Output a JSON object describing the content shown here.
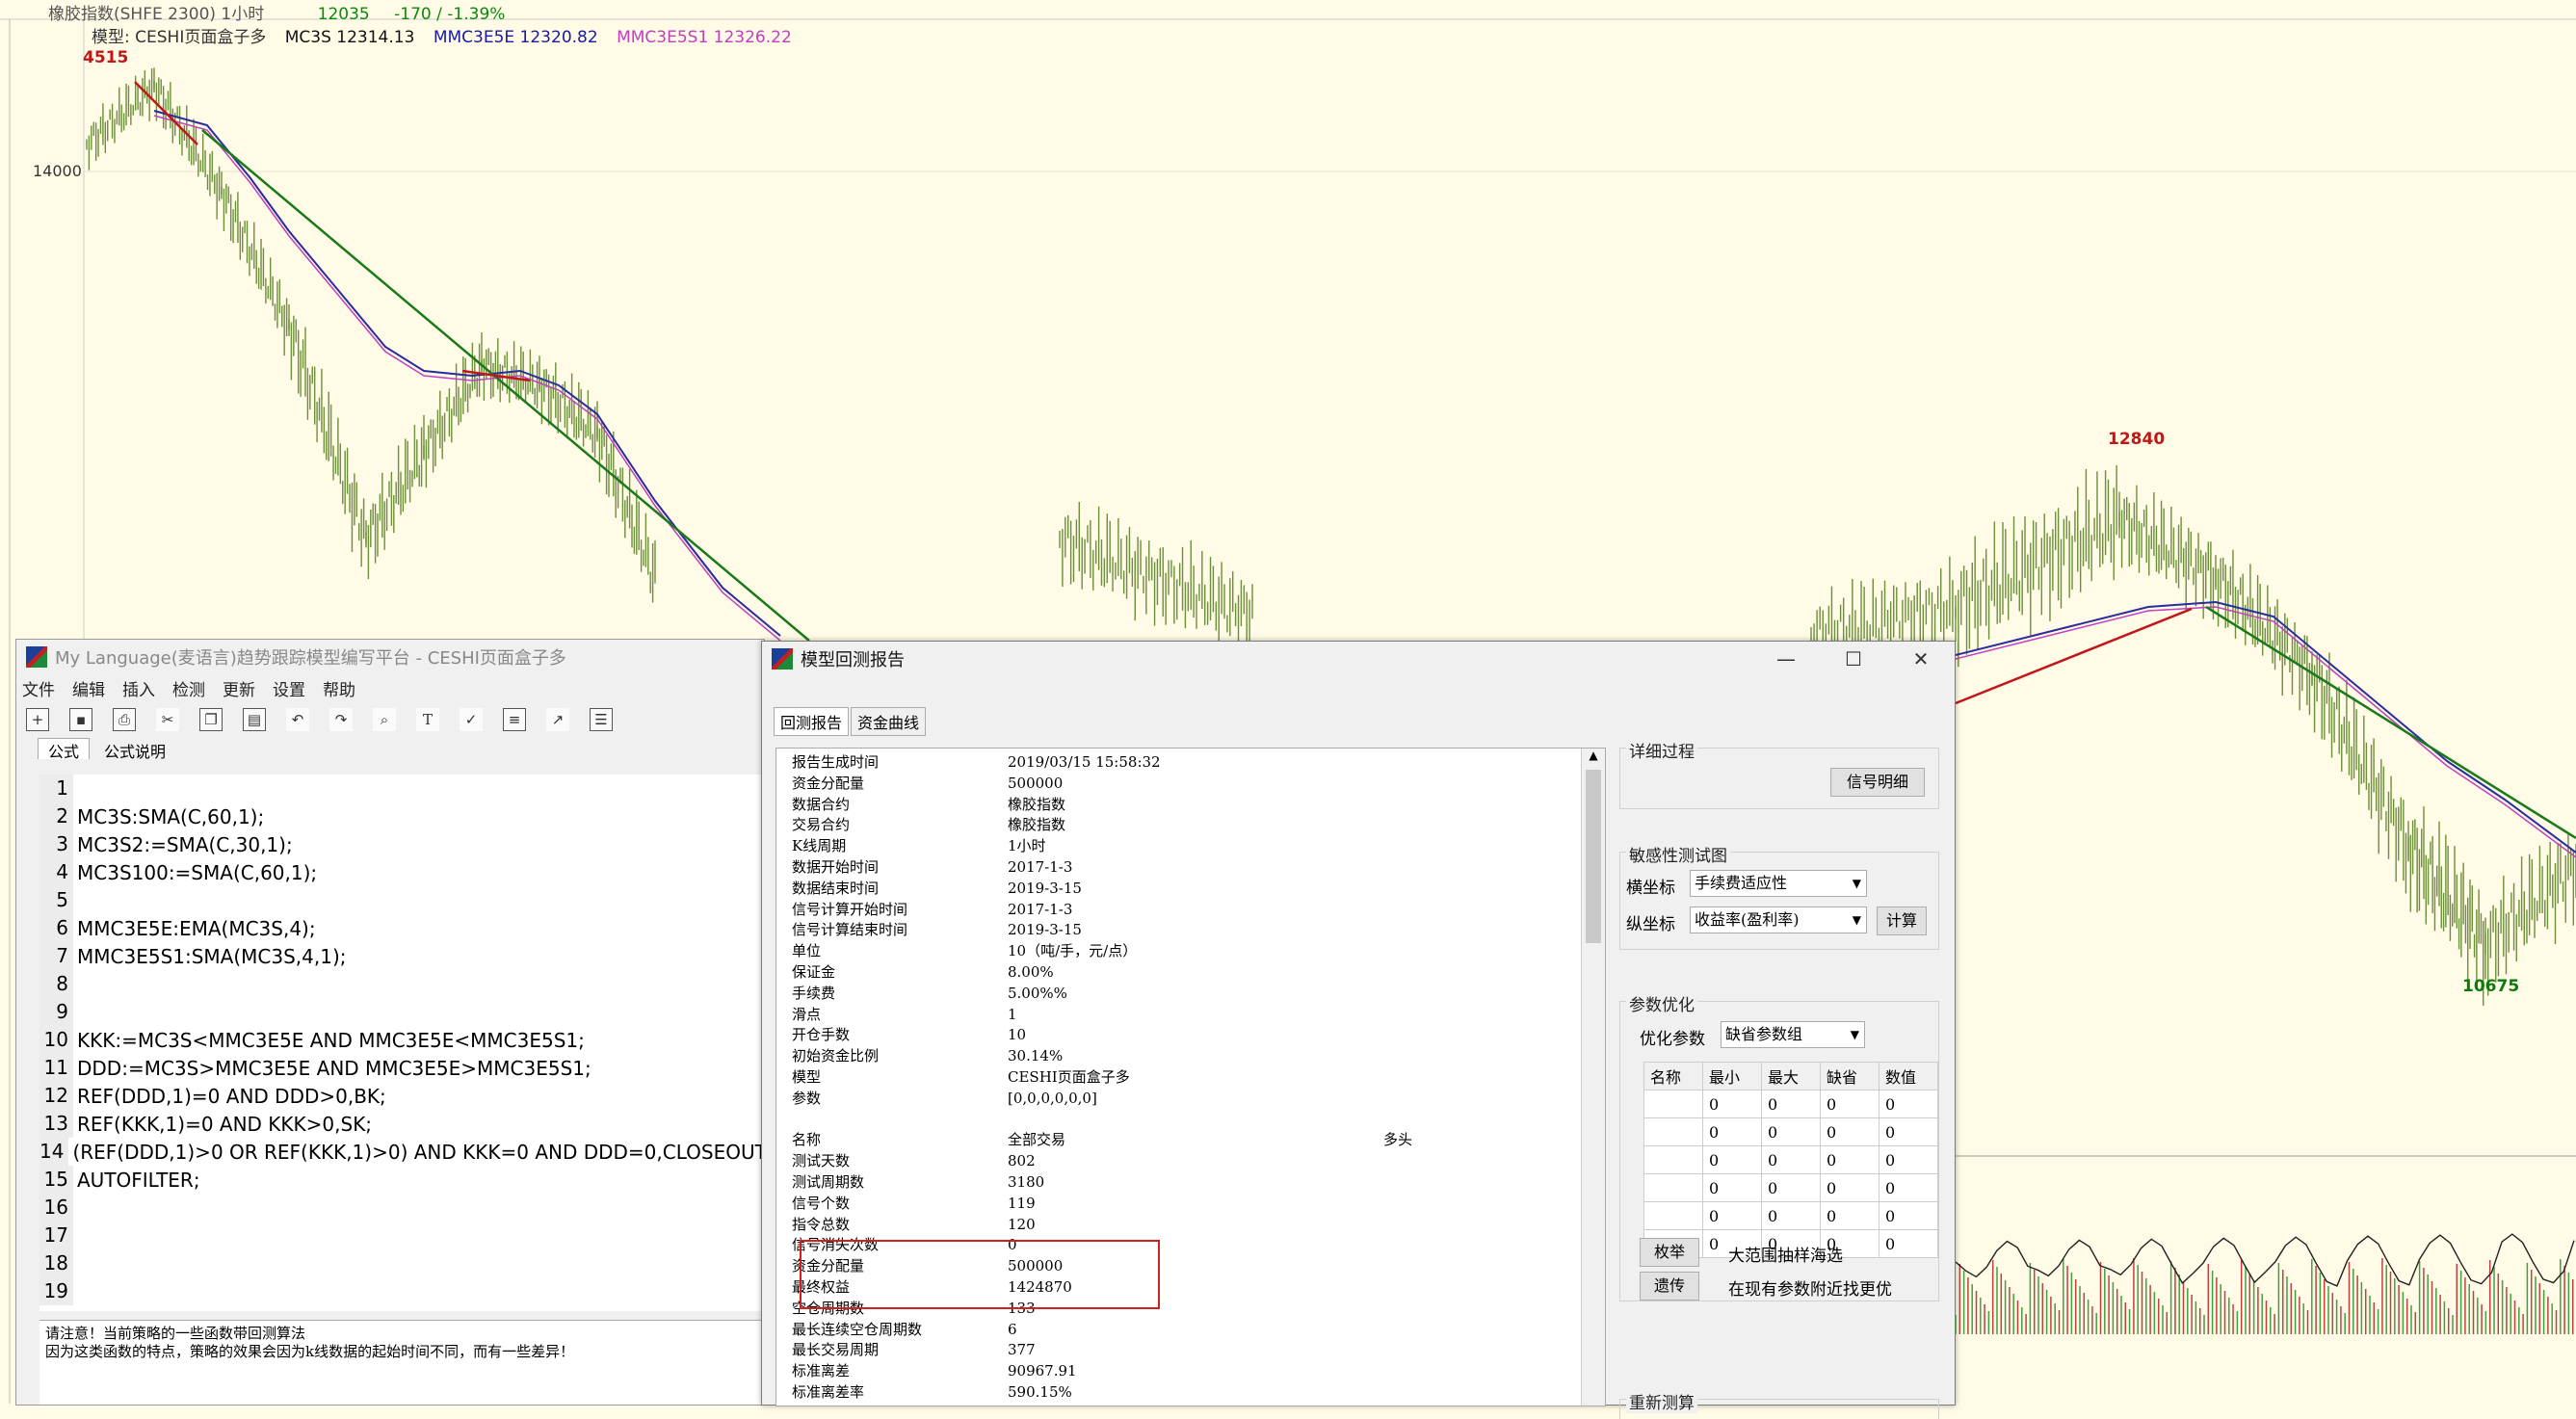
{
  "chart": {
    "header": "橡胶指数(SHFE 2300) 1小时",
    "last_price": "12035",
    "change": "-170 / -1.39%",
    "legend": [
      {
        "label": "模型: CESHI页面盒子多",
        "color": "#333333"
      },
      {
        "label": "MC3S 12314.13",
        "color": "#111111"
      },
      {
        "label": "MMC3E5E 12320.82",
        "color": "#1a1aa0"
      },
      {
        "label": "MMC3E5S1 12326.22",
        "color": "#c040c0"
      }
    ],
    "y_axis_label": "14000",
    "high_label": "4515",
    "mid_high_label": "12840",
    "low_label": "10675",
    "colors": {
      "price": "#6b8f3a",
      "trend": "#1a7a1a",
      "signal": "#c01818",
      "ma1": "#2b2ba0",
      "ma2": "#c040c0",
      "bg": "#fffbe6"
    }
  },
  "editor": {
    "title": "My Language(麦语言)趋势跟踪模型编写平台 - CESHI页面盒子多",
    "menu": [
      "文件",
      "编辑",
      "插入",
      "检测",
      "更新",
      "设置",
      "帮助"
    ],
    "toolbar_icons": [
      "new-file-icon",
      "save-icon",
      "print-icon",
      "cut-icon",
      "copy-icon",
      "paste-icon",
      "undo-icon",
      "redo-icon",
      "search-icon",
      "text-icon",
      "spellcheck-icon",
      "compile-icon",
      "chart-icon",
      "document-icon"
    ],
    "tabs": [
      "公式",
      "公式说明"
    ],
    "lines": [
      {
        "n": "1",
        "t": ""
      },
      {
        "n": "2",
        "t": "MC3S:SMA(C,60,1);"
      },
      {
        "n": "3",
        "t": "MC3S2:=SMA(C,30,1);"
      },
      {
        "n": "4",
        "t": "MC3S100:=SMA(C,60,1);"
      },
      {
        "n": "5",
        "t": ""
      },
      {
        "n": "6",
        "t": "MMC3E5E:EMA(MC3S,4);"
      },
      {
        "n": "7",
        "t": "MMC3E5S1:SMA(MC3S,4,1);"
      },
      {
        "n": "8",
        "t": ""
      },
      {
        "n": "9",
        "t": ""
      },
      {
        "n": "10",
        "t": "KKK:=MC3S<MMC3E5E AND MMC3E5E<MMC3E5S1;"
      },
      {
        "n": "11",
        "t": "DDD:=MC3S>MMC3E5E AND MMC3E5E>MMC3E5S1;"
      },
      {
        "n": "12",
        "t": "REF(DDD,1)=0 AND DDD>0,BK;"
      },
      {
        "n": "13",
        "t": "REF(KKK,1)=0 AND KKK>0,SK;"
      },
      {
        "n": "14",
        "t": "(REF(DDD,1)>0 OR REF(KKK,1)>0) AND KKK=0 AND DDD=0,CLOSEOUT;"
      },
      {
        "n": "15",
        "t": "AUTOFILTER;"
      },
      {
        "n": "16",
        "t": ""
      },
      {
        "n": "17",
        "t": ""
      },
      {
        "n": "18",
        "t": ""
      },
      {
        "n": "19",
        "t": ""
      }
    ],
    "notice_line1": "请注意！当前策略的一些函数带回测算法",
    "notice_line2": "因为这类函数的特点，策略的效果会因为k线数据的起始时间不同，而有一些差异！"
  },
  "report": {
    "title": "模型回测报告",
    "tabs": [
      "回测报告",
      "资金曲线"
    ],
    "rows1": [
      {
        "k": "报告生成时间",
        "v": "2019/03/15 15:58:32"
      },
      {
        "k": "资金分配量",
        "v": "500000"
      },
      {
        "k": "数据合约",
        "v": "橡胶指数"
      },
      {
        "k": "交易合约",
        "v": "橡胶指数"
      },
      {
        "k": "K线周期",
        "v": "1小时"
      },
      {
        "k": "数据开始时间",
        "v": "2017-1-3"
      },
      {
        "k": "数据结束时间",
        "v": "2019-3-15"
      },
      {
        "k": "信号计算开始时间",
        "v": "2017-1-3"
      },
      {
        "k": "信号计算结束时间",
        "v": "2019-3-15"
      },
      {
        "k": "单位",
        "v": "10（吨/手，元/点）"
      },
      {
        "k": "保证金",
        "v": "8.00%"
      },
      {
        "k": "手续费",
        "v": "5.00%%"
      },
      {
        "k": "滑点",
        "v": "1"
      },
      {
        "k": "开仓手数",
        "v": "10"
      },
      {
        "k": "初始资金比例",
        "v": "30.14%"
      },
      {
        "k": "模型",
        "v": "CESHI页面盒子多"
      },
      {
        "k": "参数",
        "v": "[0,0,0,0,0,0]"
      }
    ],
    "header_row": {
      "k": "名称",
      "v": "全部交易",
      "v2": "多头"
    },
    "rows2": [
      {
        "k": "测试天数",
        "v": "802"
      },
      {
        "k": "测试周期数",
        "v": "3180"
      },
      {
        "k": "信号个数",
        "v": "119"
      },
      {
        "k": "指令总数",
        "v": "120"
      },
      {
        "k": "信号消失次数",
        "v": "0"
      },
      {
        "k": "资金分配量",
        "v": "500000"
      },
      {
        "k": "最终权益",
        "v": "1424870"
      },
      {
        "k": "空仓周期数",
        "v": "133"
      },
      {
        "k": "最长连续空仓周期数",
        "v": "6"
      },
      {
        "k": "最长交易周期",
        "v": "377"
      },
      {
        "k": "标准离差",
        "v": "90967.91"
      },
      {
        "k": "标准离差率",
        "v": "590.15%"
      }
    ],
    "detail": {
      "title": "详细过程",
      "button": "信号明细"
    },
    "sensitivity": {
      "title": "敏感性测试图",
      "x_label": "横坐标",
      "x_value": "手续费适应性",
      "y_label": "纵坐标",
      "y_value": "收益率(盈利率)",
      "calc_button": "计算"
    },
    "optimize": {
      "title": "参数优化",
      "label": "优化参数",
      "combo": "缺省参数组",
      "headers": [
        "名称",
        "最小",
        "最大",
        "缺省",
        "数值"
      ],
      "rows": [
        [
          "",
          "0",
          "0",
          "0",
          "0"
        ],
        [
          "",
          "0",
          "0",
          "0",
          "0"
        ],
        [
          "",
          "0",
          "0",
          "0",
          "0"
        ],
        [
          "",
          "0",
          "0",
          "0",
          "0"
        ],
        [
          "",
          "0",
          "0",
          "0",
          "0"
        ],
        [
          "",
          "0",
          "0",
          "0",
          "0"
        ]
      ],
      "enum_button": "枚举",
      "enum_desc": "大范围抽样海选",
      "genetic_button": "遗传",
      "genetic_desc": "在现有参数附近找更优"
    },
    "retest_title": "重新测算"
  }
}
